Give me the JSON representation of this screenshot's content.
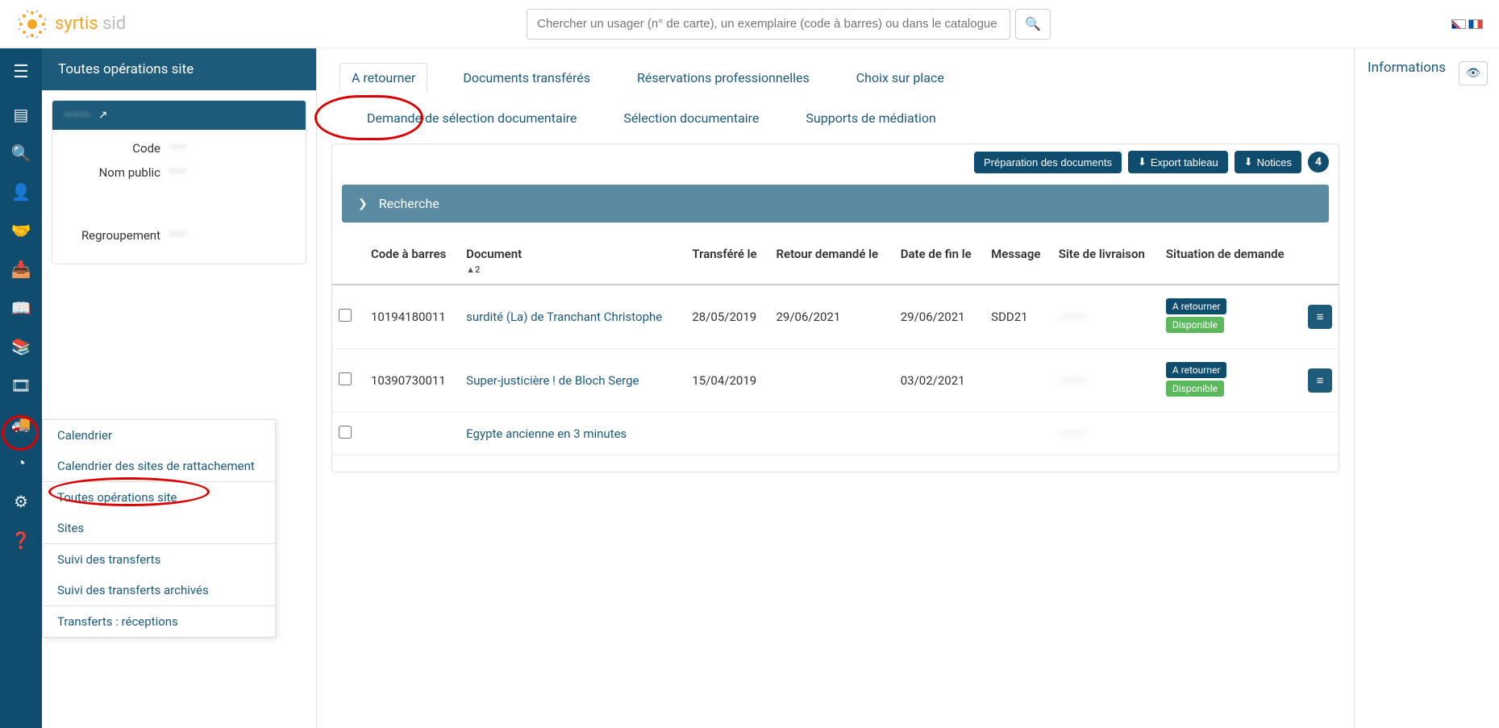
{
  "logo": {
    "part1": "syrtis ",
    "part2": "sid"
  },
  "search": {
    "placeholder": "Chercher un usager (n° de carte), un exemplaire (code à barres) ou dans le catalogue"
  },
  "sidebar": {
    "title": "Toutes opérations site",
    "info": {
      "code_label": "Code",
      "code_value": "——",
      "name_label": "Nom public",
      "name_value": "——",
      "group_label": "Regroupement",
      "group_value": "——"
    }
  },
  "flyout": {
    "items": [
      "Calendrier",
      "Calendrier des sites de rattachement",
      "Toutes opérations site",
      "Sites",
      "Suivi des transferts",
      "Suivi des transferts archivés",
      "Transferts : réceptions"
    ]
  },
  "tabs": {
    "row1": [
      "A retourner",
      "Documents transférés",
      "Réservations professionnelles",
      "Choix sur place"
    ],
    "row2": [
      "Demande de sélection documentaire",
      "Sélection documentaire",
      "Supports de médiation"
    ]
  },
  "actions": {
    "prep": "Préparation des documents",
    "export": "Export tableau",
    "notices": "Notices",
    "count": "4"
  },
  "search_panel": {
    "label": "Recherche"
  },
  "table": {
    "headers": {
      "barcode": "Code à barres",
      "doc": "Document",
      "sort": "▲2",
      "transferred": "Transféré le",
      "return_req": "Retour demandé le",
      "end_date": "Date de fin le",
      "message": "Message",
      "delivery": "Site de livraison",
      "status": "Situation de demande"
    },
    "rows": [
      {
        "barcode": "10194180011",
        "doc": "surdité (La) de Tranchant Christophe",
        "transferred": "28/05/2019",
        "return_req": "29/06/2021",
        "end_date": "29/06/2021",
        "message": "SDD21",
        "delivery": "",
        "tag1": "A retourner",
        "tag2": "Disponible"
      },
      {
        "barcode": "10390730011",
        "doc": "Super-justicière ! de Bloch Serge",
        "transferred": "15/04/2019",
        "return_req": "",
        "end_date": "03/02/2021",
        "message": "",
        "delivery": "",
        "tag1": "A retourner",
        "tag2": "Disponible"
      },
      {
        "barcode": "",
        "doc": "Egypte ancienne en 3 minutes",
        "transferred": "",
        "return_req": "",
        "end_date": "",
        "message": "",
        "delivery": "",
        "tag1": "",
        "tag2": ""
      }
    ]
  },
  "right": {
    "title": "Informations"
  }
}
